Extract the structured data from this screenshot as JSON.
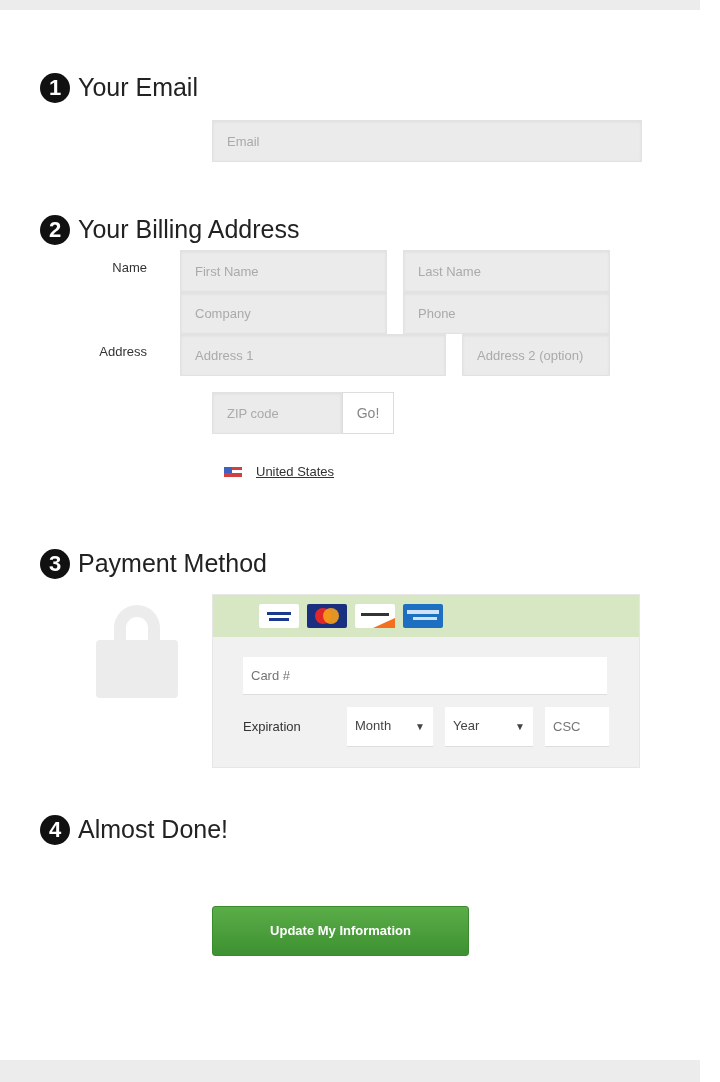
{
  "sections": [
    {
      "number": "1",
      "title": "Your Email"
    },
    {
      "number": "2",
      "title": "Your Billing Address"
    },
    {
      "number": "3",
      "title": "Payment Method"
    },
    {
      "number": "4",
      "title": "Almost Done!"
    }
  ],
  "email": {
    "placeholder": "Email"
  },
  "billing": {
    "name_label": "Name",
    "first_name": {
      "placeholder": "First Name"
    },
    "last_name": {
      "placeholder": "Last Name"
    },
    "company": {
      "placeholder": "Company"
    },
    "phone": {
      "placeholder": "Phone"
    },
    "address_label": "Address",
    "address1": {
      "placeholder": "Address 1"
    },
    "address2": {
      "placeholder": "Address 2 (option)"
    },
    "zip": {
      "placeholder": "ZIP code"
    },
    "zip_button": "Go!",
    "country": "United States"
  },
  "payment": {
    "card_number": {
      "placeholder": "Card #"
    },
    "expiration_label": "Expiration",
    "month": {
      "value": "Month",
      "arrow": "▼"
    },
    "year": {
      "value": "Year",
      "arrow": "▼"
    },
    "csc": {
      "placeholder": "CSC"
    }
  },
  "submit": "Update My Information"
}
